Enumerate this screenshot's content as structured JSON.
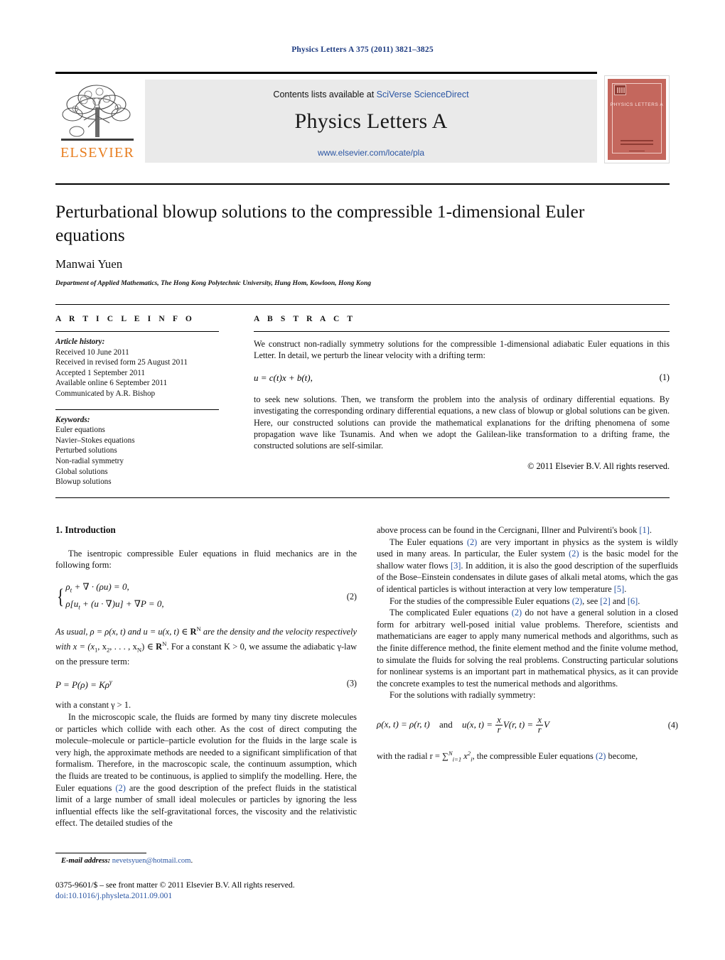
{
  "running_head": "Physics Letters A 375 (2011) 3821–3825",
  "masthead": {
    "contents_prefix": "Contents lists available at ",
    "contents_link": "SciVerse ScienceDirect",
    "journal_title": "Physics Letters A",
    "journal_url": "www.elsevier.com/locate/pla",
    "publisher_name": "ELSEVIER",
    "publisher_color": "#e87d1e",
    "cover_title": "PHYSICS LETTERS A",
    "cover_color": "#c4675d"
  },
  "article": {
    "title": "Perturbational blowup solutions to the compressible 1-dimensional Euler equations",
    "author": "Manwai Yuen",
    "affiliation": "Department of Applied Mathematics, The Hong Kong Polytechnic University, Hung Hom, Kowloon, Hong Kong"
  },
  "info": {
    "heading": "A R T I C L E   I N F O",
    "history_label": "Article history:",
    "history": [
      "Received 10 June 2011",
      "Received in revised form 25 August 2011",
      "Accepted 1 September 2011",
      "Available online 6 September 2011",
      "Communicated by A.R. Bishop"
    ],
    "keywords_label": "Keywords:",
    "keywords": [
      "Euler equations",
      "Navier–Stokes equations",
      "Perturbed solutions",
      "Non-radial symmetry",
      "Global solutions",
      "Blowup solutions"
    ]
  },
  "abstract": {
    "heading": "A B S T R A C T",
    "para1": "We construct non-radially symmetry solutions for the compressible 1-dimensional adiabatic Euler equations in this Letter. In detail, we perturb the linear velocity with a drifting term:",
    "equation1": "u = c(t)x + b(t),",
    "equation1_num": "(1)",
    "para2": "to seek new solutions. Then, we transform the problem into the analysis of ordinary differential equations. By investigating the corresponding ordinary differential equations, a new class of blowup or global solutions can be given. Here, our constructed solutions can provide the mathematical explanations for the drifting phenomena of some propagation wave like Tsunamis. And when we adopt the Galilean-like transformation to a drifting frame, the constructed solutions are self-similar.",
    "copyright": "© 2011 Elsevier B.V. All rights reserved."
  },
  "body": {
    "section_heading": "1. Introduction",
    "left": {
      "p1": "The isentropic compressible Euler equations in fluid mechanics are in the following form:",
      "eq2_line1": "ρ",
      "eq2_line1_sub": "t",
      "eq2_line1_rest": " + ∇ · (ρu) = 0,",
      "eq2_line2a": "ρ[u",
      "eq2_line2_sub": "t",
      "eq2_line2b": " + (u · ∇)u] + ∇P = 0,",
      "eq2_num": "(2)",
      "p2a": "As usual, ρ = ρ(x, t) and u = u(x, t) ∈ ",
      "p2b": " are the density and the velocity respectively with x = (x",
      "p2c": ", x",
      "p2d": ", . . . , x",
      "p2e": ") ∈ ",
      "p2f": ". For a constant K > 0, we assume the adiabatic γ-law on the pressure term:",
      "eq3": "P = P(ρ) = Kρ",
      "eq3_sup": "γ",
      "eq3_num": "(3)",
      "p3": "with a constant γ > 1.",
      "p4": "In the microscopic scale, the fluids are formed by many tiny discrete molecules or particles which collide with each other. As the cost of direct computing the molecule–molecule or particle–particle evolution for the fluids in the large scale is very high, the approximate methods are needed to a significant simplification of that formalism. Therefore, in the macroscopic scale, the continuum assumption, which the fluids are treated to be continuous, is applied to simplify the modelling. Here, the Euler equations ",
      "p4_ref": "(2)",
      "p4_rest": " are the good description of the prefect fluids in the statistical limit of a large number of small ideal molecules or particles by ignoring the less influential effects like the self-gravitational forces, the viscosity and the relativistic effect. The detailed studies of the"
    },
    "right": {
      "p1a": "above process can be found in the Cercignani, Illner and Pulvirenti's book ",
      "p1_ref": "[1]",
      "p1b": ".",
      "p2a": "The Euler equations ",
      "p2_ref1": "(2)",
      "p2b": " are very important in physics as the system is wildly used in many areas. In particular, the Euler system ",
      "p2_ref2": "(2)",
      "p2c": " is the basic model for the shallow water flows ",
      "p2_ref3": "[3]",
      "p2d": ". In addition, it is also the good description of the superfluids of the Bose–Einstein condensates in dilute gases of alkali metal atoms, which the gas of identical particles is without interaction at very low temperature ",
      "p2_ref4": "[5]",
      "p2e": ".",
      "p3a": "For the studies of the compressible Euler equations ",
      "p3_ref1": "(2)",
      "p3b": ", see ",
      "p3_ref2": "[2]",
      "p3c": " and ",
      "p3_ref3": "[6]",
      "p3d": ".",
      "p4a": "The complicated Euler equations ",
      "p4_ref": "(2)",
      "p4b": " do not have a general solution in a closed form for arbitrary well-posed initial value problems. Therefore, scientists and mathematicians are eager to apply many numerical methods and algorithms, such as the finite difference method, the finite element method and the finite volume method, to simulate the fluids for solving the real problems. Constructing particular solutions for nonlinear systems is an important part in mathematical physics, as it can provide the concrete examples to test the numerical methods and algorithms.",
      "p5": "For the solutions with radially symmetry:",
      "eq4_a": "ρ(x, t) = ρ(r, t)",
      "eq4_and": "and",
      "eq4_b": "u(x, t) = ",
      "eq4_num": "(4)",
      "p6a": "with the radial r = ",
      "p6b": ", the compressible Euler equations ",
      "p6_ref": "(2)",
      "p6c": " become,"
    }
  },
  "footer": {
    "email_label": "E-mail address:",
    "email": "nevetsyuen@hotmail.com",
    "email_trail": ".",
    "imprint": "0375-9601/$ – see front matter  © 2011 Elsevier B.V. All rights reserved.",
    "doi": "doi:10.1016/j.physleta.2011.09.001"
  }
}
